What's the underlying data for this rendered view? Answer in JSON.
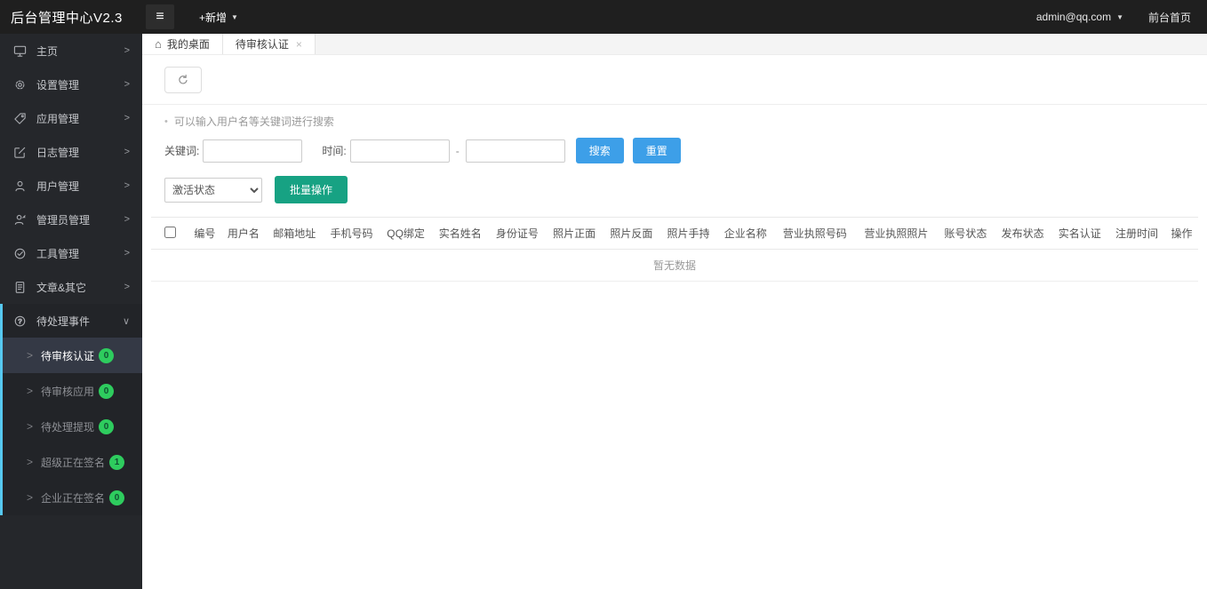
{
  "topbar": {
    "logo": "后台管理中心V2.3",
    "new_menu": "+新增",
    "account": "admin@qq.com",
    "front_home": "前台首页"
  },
  "icons": {
    "hamburger": "≡",
    "caret_down": "▼",
    "chevron_right": ">",
    "chevron_down": "∨",
    "submenu_arrow": ">",
    "home": "⌂",
    "close": "×",
    "bullet": "•"
  },
  "sidebar": {
    "items": [
      {
        "label": "主页",
        "icon": "monitor-icon"
      },
      {
        "label": "设置管理",
        "icon": "gear-icon"
      },
      {
        "label": "应用管理",
        "icon": "tag-icon"
      },
      {
        "label": "日志管理",
        "icon": "edit-square-icon"
      },
      {
        "label": "用户管理",
        "icon": "user-icon"
      },
      {
        "label": "管理员管理",
        "icon": "admin-user-icon"
      },
      {
        "label": "工具管理",
        "icon": "tools-circle-icon"
      },
      {
        "label": "文章&其它",
        "icon": "article-icon"
      }
    ],
    "expanded_item": {
      "label": "待处理事件",
      "icon": "question-circle-icon"
    },
    "submenu": [
      {
        "label": "待审核认证",
        "badge": "0",
        "active": true
      },
      {
        "label": "待审核应用",
        "badge": "0",
        "active": false
      },
      {
        "label": "待处理提现",
        "badge": "0",
        "active": false
      },
      {
        "label": "超级正在签名",
        "badge": "1",
        "active": false
      },
      {
        "label": "企业正在签名",
        "badge": "0",
        "active": false
      }
    ]
  },
  "tabs": [
    {
      "label": "我的桌面"
    },
    {
      "label": "待审核认证"
    }
  ],
  "search": {
    "hint": "可以输入用户名等关键词进行搜索",
    "keyword_label": "关键词:",
    "time_label": "时间:",
    "separator": "-",
    "keyword_value": "",
    "time_from_value": "",
    "time_to_value": "",
    "search_button": "搜索",
    "reset_button": "重置",
    "status_select": "激活状态",
    "batch_button": "批量操作"
  },
  "table": {
    "headers": [
      "编号",
      "用户名",
      "邮箱地址",
      "手机号码",
      "QQ绑定",
      "实名姓名",
      "身份证号",
      "照片正面",
      "照片反面",
      "照片手持",
      "企业名称",
      "营业执照号码",
      "营业执照照片",
      "账号状态",
      "发布状态",
      "实名认证",
      "注册时间",
      "操作"
    ],
    "empty_text": "暂无数据"
  },
  "colors": {
    "topbar_bg": "#1f1f1f",
    "sidebar_bg": "#25272b",
    "active_submenu_bg": "#343945",
    "sidebar_accent_strip": "#56c8f0",
    "badge_green": "#2ecc5e",
    "button_blue": "#3d9fe8",
    "button_green": "#17a283"
  }
}
